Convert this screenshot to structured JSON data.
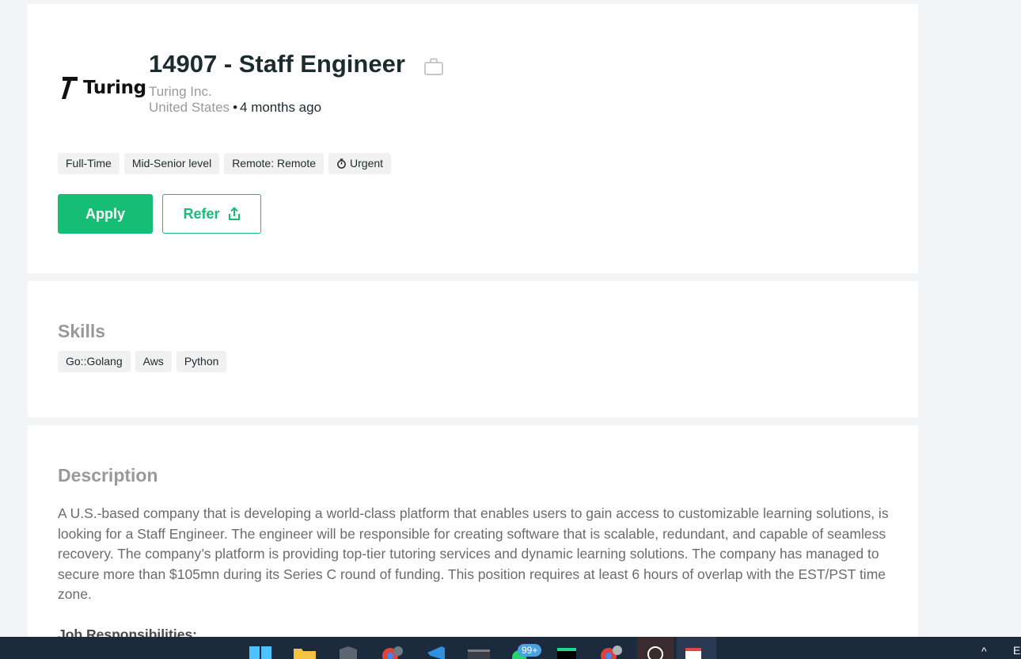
{
  "job": {
    "company_logo_text": "Turing",
    "title": "14907 - Staff Engineer",
    "company": "Turing Inc.",
    "location": "United States",
    "separator": "•",
    "posted": "4 months ago",
    "tags": [
      "Full-Time",
      "Mid-Senior level",
      "Remote: Remote",
      "Urgent"
    ],
    "apply_label": "Apply",
    "refer_label": "Refer"
  },
  "skills": {
    "heading": "Skills",
    "items": [
      "Go::Golang",
      "Aws",
      "Python"
    ]
  },
  "description": {
    "heading": "Description",
    "body": "A U.S.-based company that is developing a world-class platform that enables users to gain access to customizable learning solutions, is looking for a Staff Engineer. The engineer will be responsible for creating software that is scalable, redundant, and capable of seamless recovery. The company’s platform is providing top-tier tutoring services and dynamic learning solutions. The company has managed to secure more than $105mn during its Series C round of funding. This position requires at least 6 hours of overlap with the EST/PST time zone.",
    "subheading": "Job Responsibilities:"
  },
  "taskbar": {
    "notification_badge": "99+",
    "tray_chevron": "^",
    "clock_partial": "E"
  },
  "colors": {
    "accent": "#15bd75",
    "heading_gray": "#999999",
    "tag_bg": "#f1f1f1",
    "taskbar_bg": "#1b2a3d"
  },
  "icons": {
    "title": "briefcase-icon",
    "urgent_tag": "stopwatch-icon",
    "refer_button": "share-icon"
  }
}
